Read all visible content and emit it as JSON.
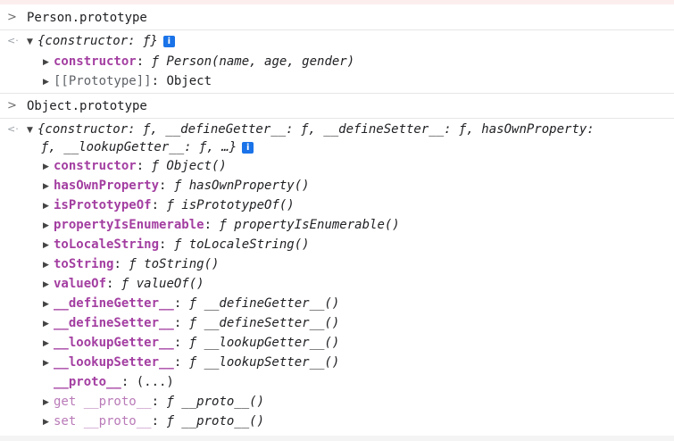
{
  "console": {
    "input1": "Person.prototype",
    "output1": {
      "summary": "{constructor: ƒ}",
      "info_label": "i",
      "props": [
        {
          "key": "constructor",
          "value": "ƒ Person(name, age, gender)"
        },
        {
          "key": "[[Prototype]]",
          "value": "Object"
        }
      ]
    },
    "input2": "Object.prototype",
    "output2": {
      "summary_line1": "{constructor: ƒ, __defineGetter__: ƒ, __defineSetter__: ƒ, hasOwnProperty:",
      "summary_line2": "ƒ, __lookupGetter__: ƒ, …}",
      "info_label": "i",
      "props": [
        {
          "key": "constructor",
          "value": "ƒ Object()"
        },
        {
          "key": "hasOwnProperty",
          "value": "ƒ hasOwnProperty()"
        },
        {
          "key": "isPrototypeOf",
          "value": "ƒ isPrototypeOf()"
        },
        {
          "key": "propertyIsEnumerable",
          "value": "ƒ propertyIsEnumerable()"
        },
        {
          "key": "toLocaleString",
          "value": "ƒ toLocaleString()"
        },
        {
          "key": "toString",
          "value": "ƒ toString()"
        },
        {
          "key": "valueOf",
          "value": "ƒ valueOf()"
        },
        {
          "key": "__defineGetter__",
          "value": "ƒ __defineGetter__()"
        },
        {
          "key": "__defineSetter__",
          "value": "ƒ __defineSetter__()"
        },
        {
          "key": "__lookupGetter__",
          "value": "ƒ __lookupGetter__()"
        },
        {
          "key": "__lookupSetter__",
          "value": "ƒ __lookupSetter__()"
        },
        {
          "key": "__proto__",
          "value": "(...)"
        },
        {
          "key": "get __proto__",
          "value": "ƒ __proto__()"
        },
        {
          "key": "set __proto__",
          "value": "ƒ __proto__()"
        }
      ]
    }
  },
  "icons": {
    "input_prompt": "chevron-right-icon",
    "output_marker": "return-arrow-icon",
    "expand": "triangle-expand-icon",
    "info": "info-icon"
  },
  "colors": {
    "property_key": "#a33ea1",
    "info_badge": "#1a73e8"
  }
}
